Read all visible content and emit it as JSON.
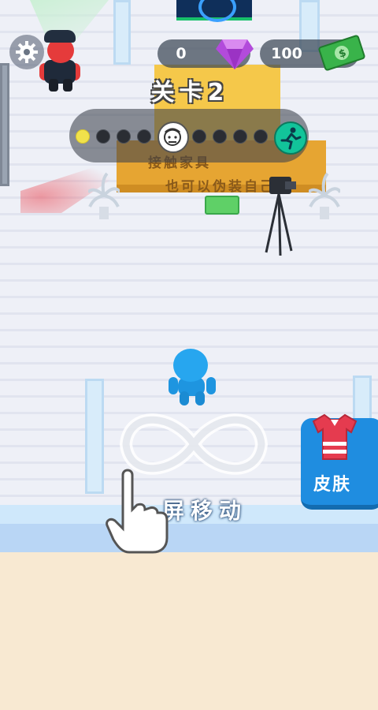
{
  "hud": {
    "gems": "0",
    "cash": "100",
    "level_title": "关卡2"
  },
  "progress": {
    "total_dots": 10,
    "current_dot": 1
  },
  "scene": {
    "wall_text_1": "接触家具",
    "wall_text_2": "也可以伪装自己"
  },
  "skin_button": {
    "label": "皮肤"
  },
  "tutorial": {
    "hint": "屏移动"
  },
  "icons": {
    "settings": "gear-icon",
    "gems": "diamond-icon",
    "cash": "money-bill-icon",
    "target": "target-face-icon",
    "exit": "runner-exit-icon",
    "skin": "shirt-icon",
    "gesture": "infinity-swipe-icon",
    "hand": "pointing-hand-icon"
  },
  "colors": {
    "player": "#27a6ef",
    "guard": "#e53b3b",
    "gold": "#e6a532",
    "skin_button": "#1f8de0",
    "active_dot": "#f1e24b"
  }
}
